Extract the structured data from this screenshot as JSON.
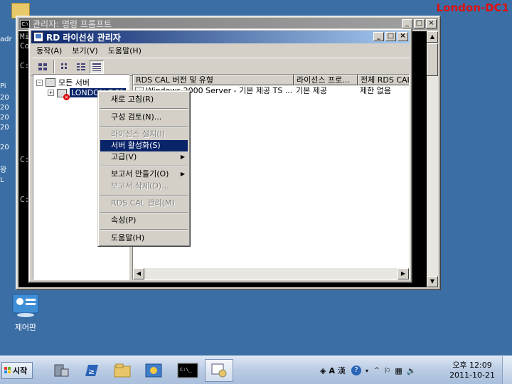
{
  "host_label": "London-DC1",
  "desktop": {
    "side_text": [
      "adr",
      "Pi",
      "20",
      "20",
      "20",
      "20",
      "20",
      "왕",
      "L"
    ],
    "control_panel_label": "제어판"
  },
  "cmd_window": {
    "title": "관리자: 명령 프롬프트",
    "icon_text": "C:\\",
    "buttons": {
      "minimize": "_",
      "maximize": "□",
      "close": "×"
    },
    "lines": [
      "Mi",
      "Co",
      "",
      "C:",
      "",
      "C:",
      "",
      "C:"
    ]
  },
  "rd_window": {
    "title": "RD 라이선싱 관리자",
    "buttons": {
      "minimize": "_",
      "maximize": "□",
      "close": "×"
    },
    "menu": [
      "동작(A)",
      "보기(V)",
      "도움말(H)"
    ],
    "tree": {
      "root_label": "모든 서버",
      "root_toggle": "−",
      "server_label": "LONDON-DC1",
      "server_toggle": "+"
    },
    "list": {
      "columns": [
        "RDS CAL 버전 및 유형",
        "라이선스 프로...",
        "전체 RDS CAL"
      ],
      "rows": [
        [
          "Windows 2000 Server -  기본 제공 TS ...",
          "기본 제공",
          "제한 없음"
        ]
      ]
    }
  },
  "context_menu": {
    "items": [
      {
        "label": "새로 고침(R)",
        "disabled": false
      },
      {
        "separator": true
      },
      {
        "label": "구성 검토(N)...",
        "disabled": false
      },
      {
        "separator": true
      },
      {
        "label": "라이선스 설치(I)",
        "disabled": true
      },
      {
        "label": "서버 활성화(S)",
        "disabled": false,
        "selected": true
      },
      {
        "label": "고급(V)",
        "disabled": false,
        "submenu": true
      },
      {
        "separator": true
      },
      {
        "label": "보고서 만들기(O)",
        "disabled": false,
        "submenu": true
      },
      {
        "label": "보고서 삭제(D)...",
        "disabled": true
      },
      {
        "separator": true
      },
      {
        "label": "RDS CAL 관리(M)",
        "disabled": true
      },
      {
        "separator": true
      },
      {
        "label": "속성(P)",
        "disabled": false
      },
      {
        "separator": true
      },
      {
        "label": "도움말(H)",
        "disabled": false
      }
    ]
  },
  "taskbar": {
    "start_label": "시작",
    "ime_a": "A",
    "ime_han": "漢",
    "clock_time": "오후 12:09",
    "clock_date": "2011-10-21"
  }
}
